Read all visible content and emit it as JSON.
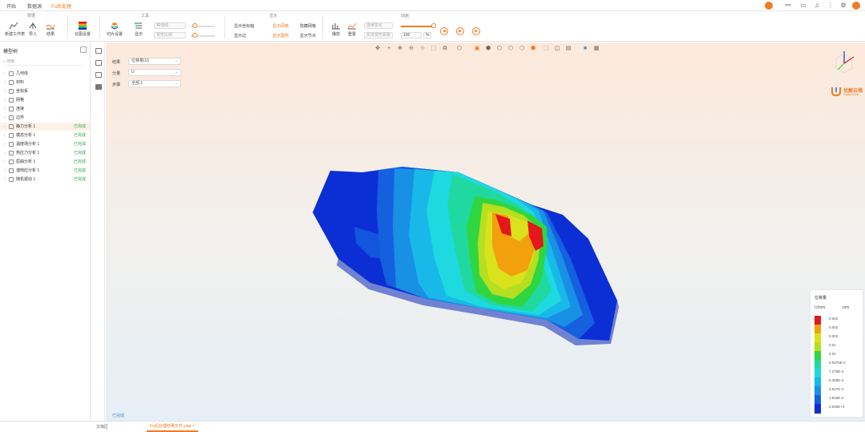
{
  "top_tabs": [
    "开始",
    "数据源",
    "Fo后处理"
  ],
  "ribbon": {
    "groups": [
      "数据",
      "工具",
      "显示",
      "动画"
    ],
    "buttons": [
      "新建工作表",
      "导入",
      "结果",
      "云图设置",
      "切片设置",
      "显示"
    ],
    "small_options": [
      "显示坐标轴",
      "显示边",
      "显示网格",
      "显示图例",
      "隐藏网格",
      "显示节点",
      "播放",
      "重置"
    ],
    "selects": [
      "等值线",
      "变形比例",
      "连续变化",
      "实体变形系数"
    ],
    "animation_value": "100",
    "animation_unit": "%"
  },
  "left_panel": {
    "title": "模型树",
    "search_placeholder": "搜索",
    "tree": [
      {
        "label": "几何体",
        "status": ""
      },
      {
        "label": "材料",
        "status": ""
      },
      {
        "label": "坐标系",
        "status": ""
      },
      {
        "label": "网格",
        "status": ""
      },
      {
        "label": "连接",
        "status": ""
      },
      {
        "label": "边界",
        "status": ""
      },
      {
        "label": "静力分析 1",
        "status": "已完成",
        "selected": true
      },
      {
        "label": "模态分析 1",
        "status": "已完成"
      },
      {
        "label": "温度场分析 1",
        "status": "已完成"
      },
      {
        "label": "热应力分析 1",
        "status": "已完成"
      },
      {
        "label": "屈曲分析 1",
        "status": "已完成"
      },
      {
        "label": "谐响应分析 1",
        "status": "已完成"
      },
      {
        "label": "随机振动 1",
        "status": "已完成"
      }
    ]
  },
  "viewport": {
    "fields": [
      {
        "label": "结果",
        "value": "位移量(U)"
      },
      {
        "label": "分量",
        "value": "U"
      },
      {
        "label": "步骤",
        "value": "全部 1"
      }
    ],
    "brand_name": "优解云境",
    "brand_sub": "OptimTech",
    "status": "已完成",
    "mesh_colors": {
      "blue": "#0b2fd4",
      "cyan": "#1fd9e0",
      "green": "#2fd640",
      "yellow": "#d9e21c",
      "orange": "#f2a10d",
      "red": "#e4171b"
    }
  },
  "legend": {
    "title": "位移量",
    "sub": "U/mm",
    "unit": "mm",
    "colors": [
      "#e4171b",
      "#f2a10d",
      "#d9e21c",
      "#b5df20",
      "#2fd640",
      "#1fd9a0",
      "#1fd9e0",
      "#18b9e8",
      "#1890e4",
      "#1460df",
      "#0b2fd4"
    ],
    "values": [
      "0.002",
      "0.002",
      "0.002",
      "0.01",
      "0.01",
      "0.0075E-4",
      "7.275E-4",
      "5.455E-4",
      "3.637E-4",
      "1.818E-4",
      "0.000E+0"
    ]
  },
  "bottom": {
    "left_text": "文档区",
    "file_tab": "Fo后处理结果文件.ydat",
    "file_close": "×"
  }
}
